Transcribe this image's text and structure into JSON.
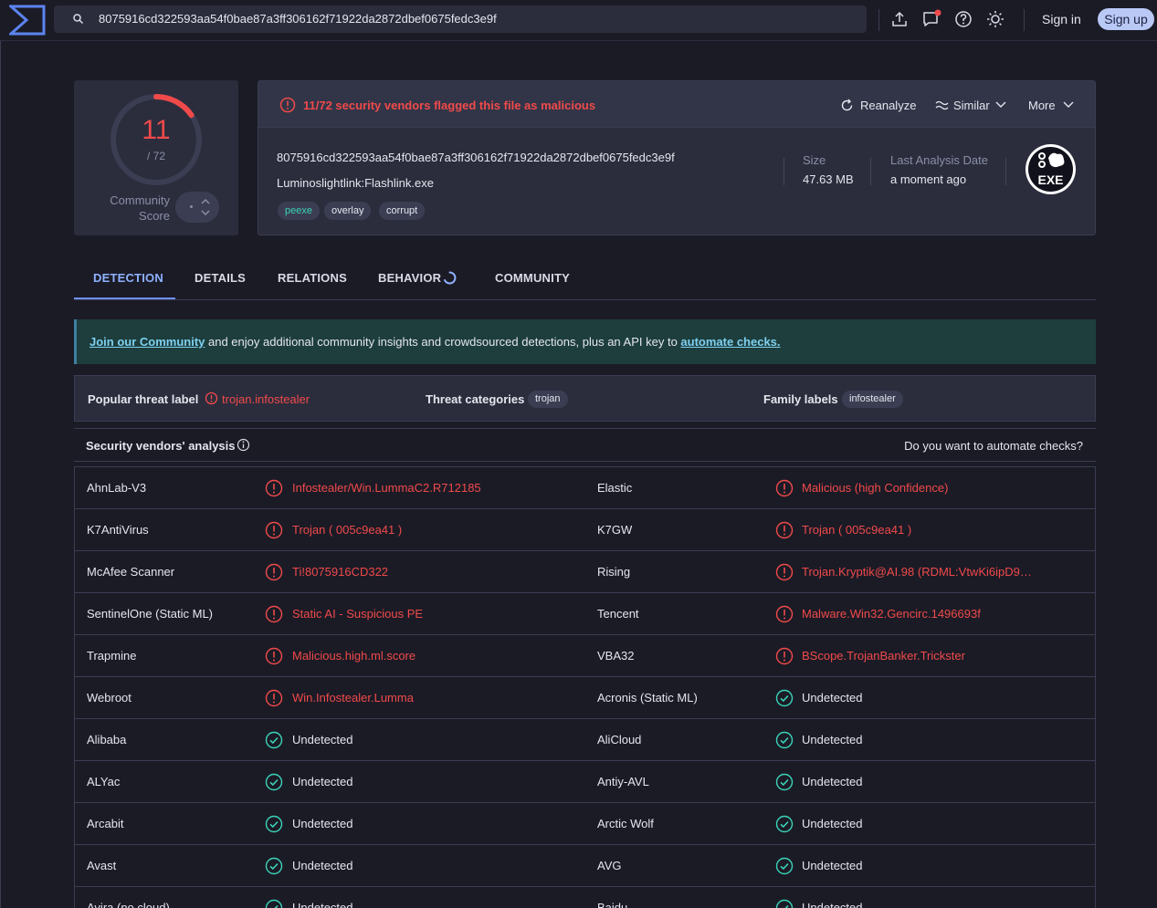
{
  "search": {
    "value": "8075916cd322593aa54f0bae87a3ff306162f71922da2872dbef0675fedc3e9f"
  },
  "header": {
    "sign_in": "Sign in",
    "sign_up": "Sign up"
  },
  "score": {
    "detected": "11",
    "total": "/ 72",
    "community_label_1": "Community",
    "community_label_2": "Score"
  },
  "summary": {
    "alert": "11/72 security vendors flagged this file as malicious",
    "reanalyze": "Reanalyze",
    "similar": "Similar",
    "more": "More",
    "hash": "8075916cd322593aa54f0bae87a3ff306162f71922da2872dbef0675fedc3e9f",
    "filename": "Luminoslightlink:Flashlink.exe",
    "tags": [
      "peexe",
      "overlay",
      "corrupt"
    ],
    "size_label": "Size",
    "size_value": "47.63 MB",
    "date_label": "Last Analysis Date",
    "date_value": "a moment ago",
    "filetype": "EXE"
  },
  "tabs": [
    "DETECTION",
    "DETAILS",
    "RELATIONS",
    "BEHAVIOR",
    "COMMUNITY"
  ],
  "banner": {
    "link1": "Join our Community",
    "middle": " and enjoy additional community insights and crowdsourced detections, plus an API key to ",
    "link2": "automate checks."
  },
  "labels": {
    "popular_title": "Popular threat label",
    "popular_value": "trojan.infostealer",
    "categories_title": "Threat categories",
    "categories_value": "trojan",
    "family_title": "Family labels",
    "family_value": "infostealer"
  },
  "vendors_header": {
    "title": "Security vendors' analysis",
    "right": "Do you want to automate checks?"
  },
  "vendors": [
    [
      {
        "name": "AhnLab-V3",
        "result": "Infostealer/Win.LummaC2.R712185",
        "malicious": true
      },
      {
        "name": "Elastic",
        "result": "Malicious (high Confidence)",
        "malicious": true
      }
    ],
    [
      {
        "name": "K7AntiVirus",
        "result": "Trojan ( 005c9ea41 )",
        "malicious": true
      },
      {
        "name": "K7GW",
        "result": "Trojan ( 005c9ea41 )",
        "malicious": true
      }
    ],
    [
      {
        "name": "McAfee Scanner",
        "result": "Ti!8075916CD322",
        "malicious": true
      },
      {
        "name": "Rising",
        "result": "Trojan.Kryptik@AI.98 (RDML:VtwKi6ipD9…",
        "malicious": true
      }
    ],
    [
      {
        "name": "SentinelOne (Static ML)",
        "result": "Static AI - Suspicious PE",
        "malicious": true
      },
      {
        "name": "Tencent",
        "result": "Malware.Win32.Gencirc.1496693f",
        "malicious": true
      }
    ],
    [
      {
        "name": "Trapmine",
        "result": "Malicious.high.ml.score",
        "malicious": true
      },
      {
        "name": "VBA32",
        "result": "BScope.TrojanBanker.Trickster",
        "malicious": true
      }
    ],
    [
      {
        "name": "Webroot",
        "result": "Win.Infostealer.Lumma",
        "malicious": true
      },
      {
        "name": "Acronis (Static ML)",
        "result": "Undetected",
        "malicious": false
      }
    ],
    [
      {
        "name": "Alibaba",
        "result": "Undetected",
        "malicious": false
      },
      {
        "name": "AliCloud",
        "result": "Undetected",
        "malicious": false
      }
    ],
    [
      {
        "name": "ALYac",
        "result": "Undetected",
        "malicious": false
      },
      {
        "name": "Antiy-AVL",
        "result": "Undetected",
        "malicious": false
      }
    ],
    [
      {
        "name": "Arcabit",
        "result": "Undetected",
        "malicious": false
      },
      {
        "name": "Arctic Wolf",
        "result": "Undetected",
        "malicious": false
      }
    ],
    [
      {
        "name": "Avast",
        "result": "Undetected",
        "malicious": false
      },
      {
        "name": "AVG",
        "result": "Undetected",
        "malicious": false
      }
    ],
    [
      {
        "name": "Avira (no cloud)",
        "result": "Undetected",
        "malicious": false
      },
      {
        "name": "Baidu",
        "result": "Undetected",
        "malicious": false
      }
    ]
  ],
  "colors": {
    "malicious": "#f04a4a",
    "clean": "#3bd3b8",
    "accent": "#8fb2ff"
  },
  "icons": [
    "logo-icon",
    "search-icon",
    "upload-icon",
    "chat-icon",
    "help-icon",
    "theme-icon",
    "alert-icon",
    "reanalyze-icon",
    "similar-icon",
    "chevron-down-icon",
    "exe-file-icon",
    "info-icon",
    "spinner-icon",
    "check-circle-icon"
  ]
}
